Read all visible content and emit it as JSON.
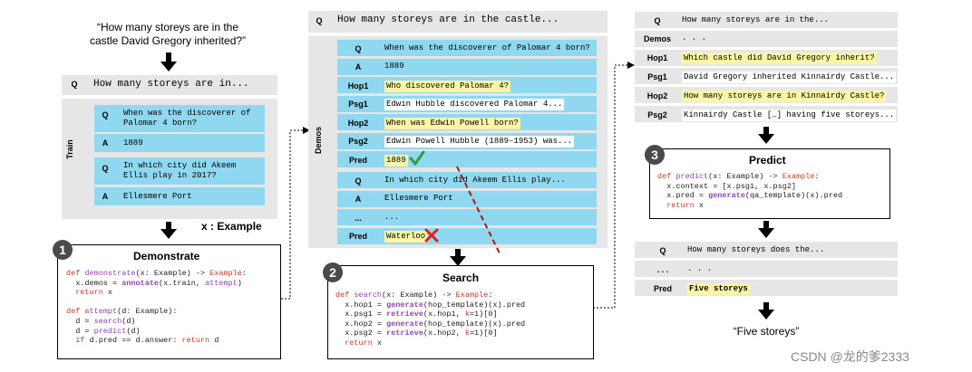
{
  "left": {
    "question": [
      "“How many storeys are in the",
      "castle David Gregory inherited?”"
    ],
    "q_label": "Q",
    "q_text": "How many storeys are in...",
    "train_label": "Train",
    "ex1_q_label": "Q",
    "ex1_q": [
      "When was the discoverer of",
      "Palomar 4 born?"
    ],
    "ex1_a_label": "A",
    "ex1_a": "1889",
    "ex2_q_label": "Q",
    "ex2_q": [
      "In which city did Akeem",
      "Ellis play in 2017?"
    ],
    "ex2_a_label": "A",
    "ex2_a": "Ellesmere Port",
    "example_tag": "x : Example",
    "step_num": "1",
    "step_title": "Demonstrate"
  },
  "middle": {
    "q_label": "Q",
    "q_text": "How many storeys are in the castle...",
    "demos_label": "Demos",
    "rows1": [
      {
        "label": "Q",
        "text": "When was the discoverer of Palomar 4 born?"
      },
      {
        "label": "A",
        "text": "1889"
      },
      {
        "label": "Hop1",
        "text": "Who discovered Palomar 4?"
      },
      {
        "label": "Psg1",
        "text": "Edwin Hubble discovered Palomar 4..."
      },
      {
        "label": "Hop2",
        "text": "When was Edwin Powell born?"
      },
      {
        "label": "Psg2",
        "text": "Edwin Powell Hubble (1889–1953) was..."
      },
      {
        "label": "Pred",
        "text": "1889"
      }
    ],
    "rows2": [
      {
        "label": "Q",
        "text": "In which city did Akeem Ellis play..."
      },
      {
        "label": "A",
        "text": "Ellesmere Port"
      },
      {
        "label": "...",
        "text": "..."
      },
      {
        "label": "Pred",
        "text": "Waterloo"
      }
    ],
    "check_icon": "check-icon",
    "cross_icon": "cross-icon",
    "step_num": "2",
    "step_title": "Search"
  },
  "right": {
    "rows": [
      {
        "label": "Q",
        "text": "How many storeys are in the..."
      },
      {
        "label": "Demos",
        "text": ". . ."
      },
      {
        "label": "Hop1",
        "text": "Which castle did David Gregory inherit?"
      },
      {
        "label": "Psg1",
        "text": "David Gregory inherited Kinnairdy Castle..."
      },
      {
        "label": "Hop2",
        "text": "How many storeys are in Kinnairdy Castle?"
      },
      {
        "label": "Psg2",
        "text": "Kinnairdy Castle […] having five storeys..."
      }
    ],
    "step_num": "3",
    "step_title": "Predict",
    "rows2": [
      {
        "label": "Q",
        "text": "How many storeys does the..."
      },
      {
        "label": ". . .",
        "text": ". . ."
      },
      {
        "label": "Pred",
        "text": "Five storeys"
      }
    ],
    "answer": "“Five storeys”"
  },
  "watermark": "CSDN @龙的爹2333",
  "colors": {
    "cyan": "#8fd8f0",
    "grey": "#e6e6e6",
    "highlight": "#fdf5a6",
    "keyword": "#c0392b",
    "function": "#8e44ad",
    "check": "#2e9e3e",
    "cross": "#e02020"
  }
}
